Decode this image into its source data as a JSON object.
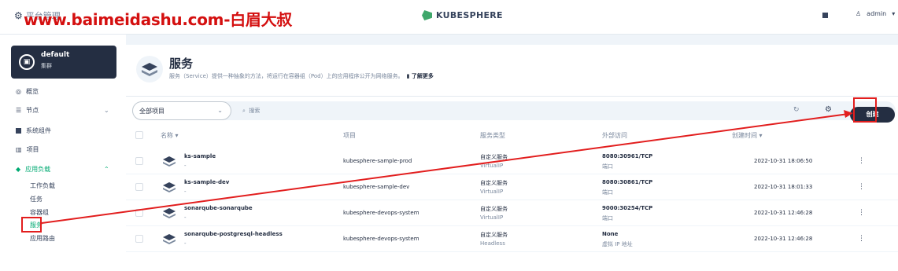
{
  "topbar": {
    "menu_label": "平台管理",
    "watermark": "www.baimeidashu.com-白眉大叔",
    "logo_text": "KUBESPHERE",
    "user_name": "admin"
  },
  "sidebar": {
    "workspace_name": "default",
    "workspace_sub": "集群",
    "items": [
      {
        "label": "概览"
      },
      {
        "label": "节点"
      },
      {
        "label": "系统组件"
      },
      {
        "label": "项目"
      },
      {
        "label": "应用负载"
      }
    ],
    "sub_items": [
      {
        "label": "工作负载"
      },
      {
        "label": "任务"
      },
      {
        "label": "容器组"
      },
      {
        "label": "服务"
      },
      {
        "label": "应用路由"
      }
    ]
  },
  "header": {
    "title": "服务",
    "description": "服务（Service）提供一种抽象的方法，将运行在容器组（Pod）上的应用程序公开为网络服务。",
    "learn_more": "了解更多"
  },
  "toolbar": {
    "project_select": "全部项目",
    "search_placeholder": "搜索",
    "create_label": "创建"
  },
  "table": {
    "columns": [
      "名称",
      "项目",
      "服务类型",
      "外部访问",
      "创建时间"
    ],
    "rows": [
      {
        "name": "ks-sample",
        "desc": "-",
        "project": "kubesphere-sample-prod",
        "type": "自定义服务",
        "type_sub": "VirtualIP",
        "access": "8080:30961/TCP",
        "access_sub": "端口",
        "created": "2022-10-31 18:06:50"
      },
      {
        "name": "ks-sample-dev",
        "desc": "-",
        "project": "kubesphere-sample-dev",
        "type": "自定义服务",
        "type_sub": "VirtualIP",
        "access": "8080:30861/TCP",
        "access_sub": "端口",
        "created": "2022-10-31 18:01:33"
      },
      {
        "name": "sonarqube-sonarqube",
        "desc": "-",
        "project": "kubesphere-devops-system",
        "type": "自定义服务",
        "type_sub": "VirtualIP",
        "access": "9000:30254/TCP",
        "access_sub": "端口",
        "created": "2022-10-31 12:46:28"
      },
      {
        "name": "sonarqube-postgresql-headless",
        "desc": "-",
        "project": "kubesphere-devops-system",
        "type": "自定义服务",
        "type_sub": "Headless",
        "access": "None",
        "access_sub": "虚拟 IP 地址",
        "created": "2022-10-31 12:46:28"
      }
    ]
  },
  "colors": {
    "accent": "#00aa72",
    "dark": "#242e42",
    "annotation": "#e21e1e"
  }
}
